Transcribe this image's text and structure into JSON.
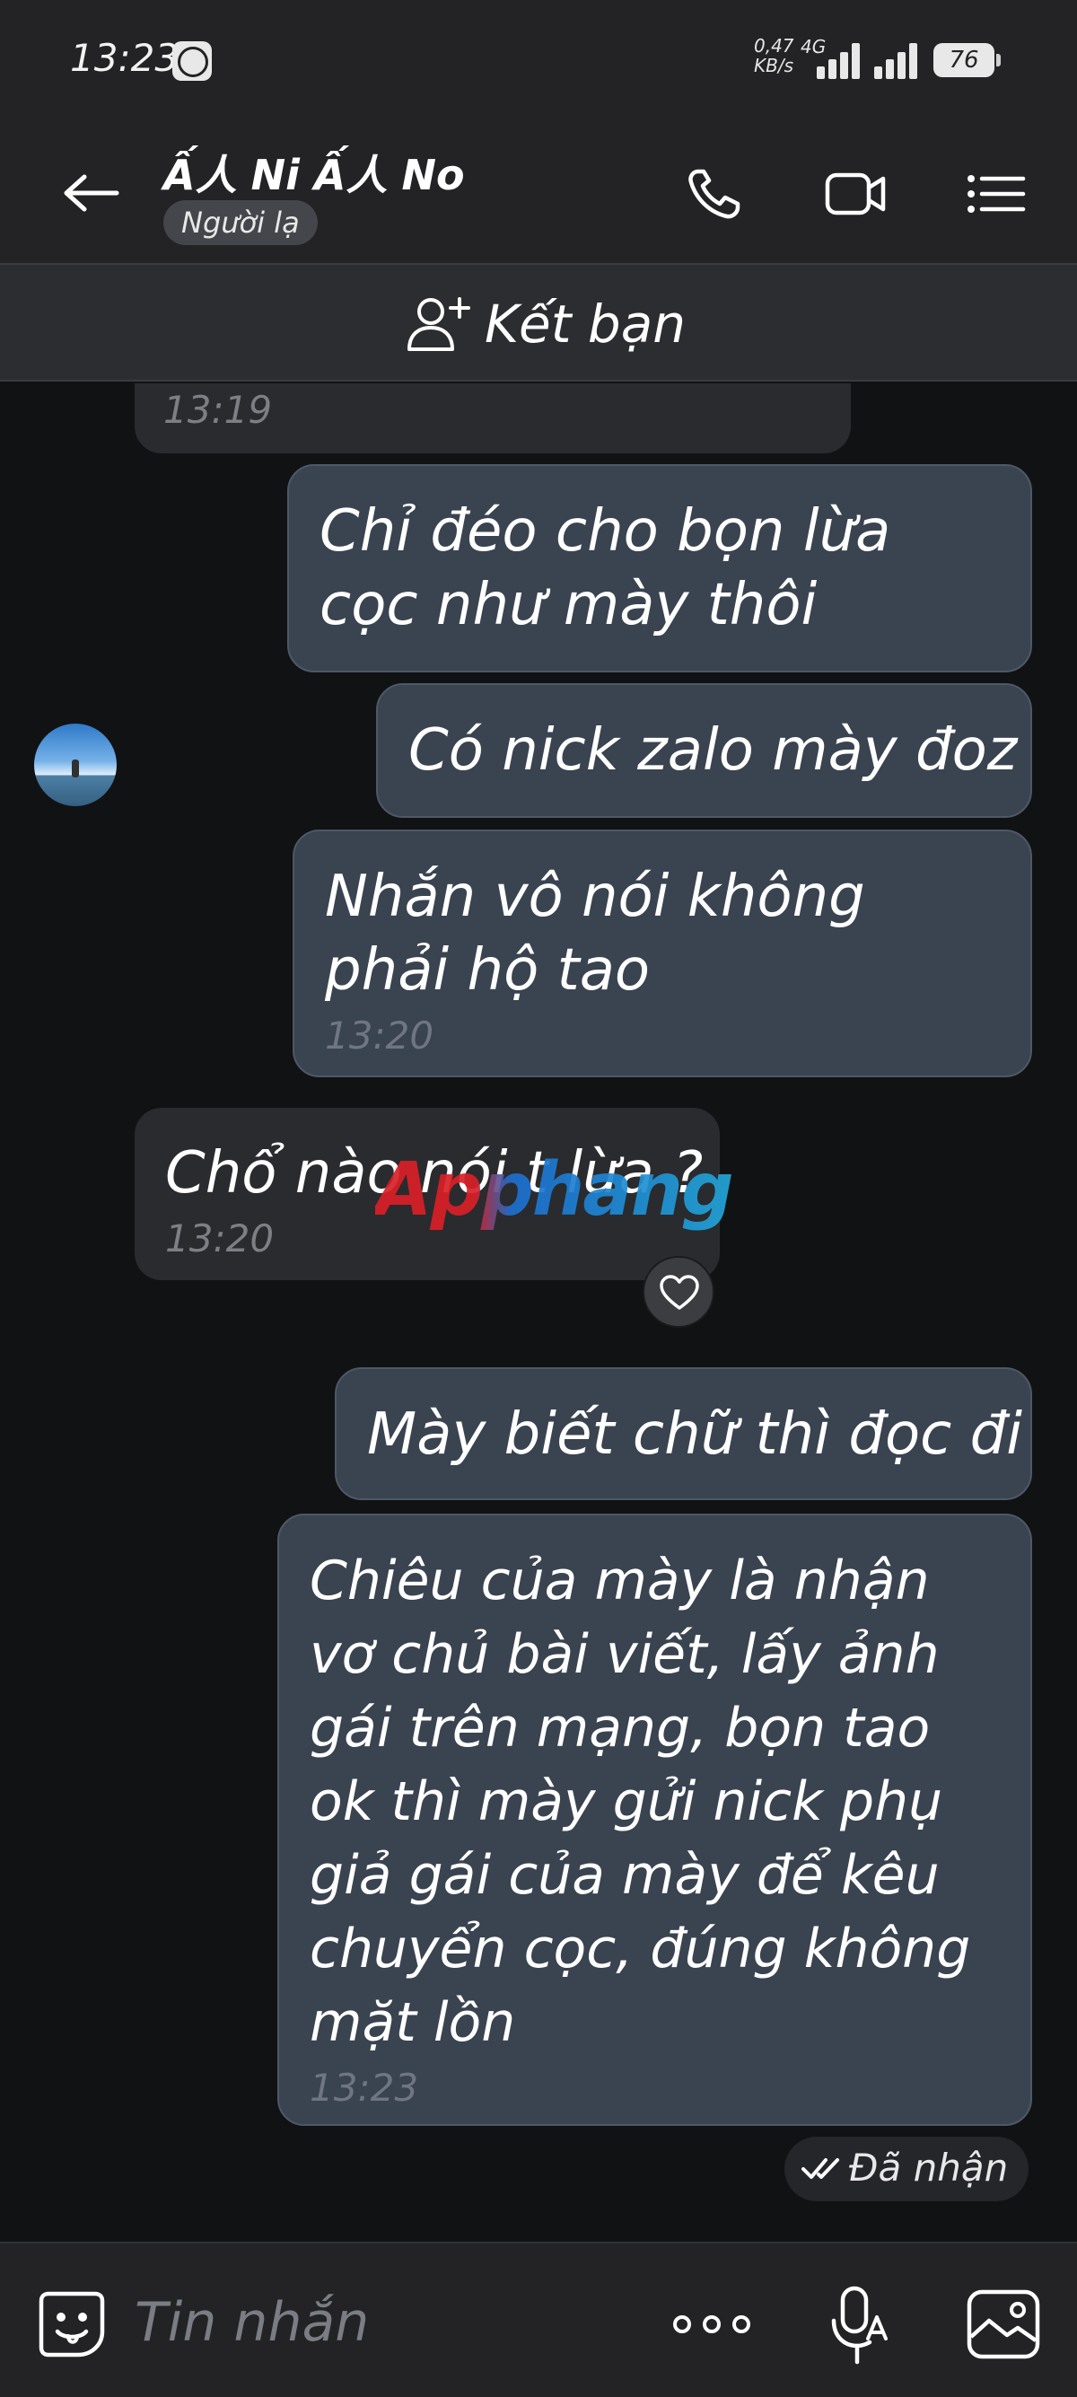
{
  "status_bar": {
    "time": "13:23",
    "net_speed_value": "0,47",
    "net_speed_unit": "KB/s",
    "network_type": "4G",
    "battery": "76"
  },
  "header": {
    "contact_name": "Ấ人 Ni Ấ人 No",
    "badge": "Người lạ",
    "icons": [
      "back-arrow-icon",
      "phone-icon",
      "video-call-icon",
      "menu-list-icon"
    ]
  },
  "add_friend": {
    "label": "Kết bạn"
  },
  "messages": [
    {
      "side": "recv",
      "text": "",
      "time": "13:19"
    },
    {
      "side": "sent",
      "text": "Chỉ đéo cho bọn lừa cọc như mày thôi",
      "time": ""
    },
    {
      "side": "sent",
      "text": "Có nick zalo mày đoz",
      "time": ""
    },
    {
      "side": "sent",
      "text": "Nhắn vô nói không phải hộ tao",
      "time": "13:20"
    },
    {
      "side": "recv",
      "text": "Chổ nào nói t lừa ?",
      "time": "13:20"
    },
    {
      "side": "sent",
      "text": "Mày biết chữ thì đọc đi",
      "time": ""
    },
    {
      "side": "sent",
      "text": "Chiêu của mày là nhận vơ chủ bài viết, lấy ảnh gái trên mạng, bọn tao ok thì mày gửi nick phụ giả gái của mày để kêu chuyển cọc, đúng không mặt lồn",
      "time": "13:23"
    }
  ],
  "watermark": "Apphang",
  "delivery_status": "Đã nhận",
  "input": {
    "placeholder": "Tin nhắn"
  },
  "colors": {
    "sent_bubble": "#3a4350",
    "recv_bubble": "#2a2b2e",
    "background": "#111214",
    "bar": "#232326"
  }
}
